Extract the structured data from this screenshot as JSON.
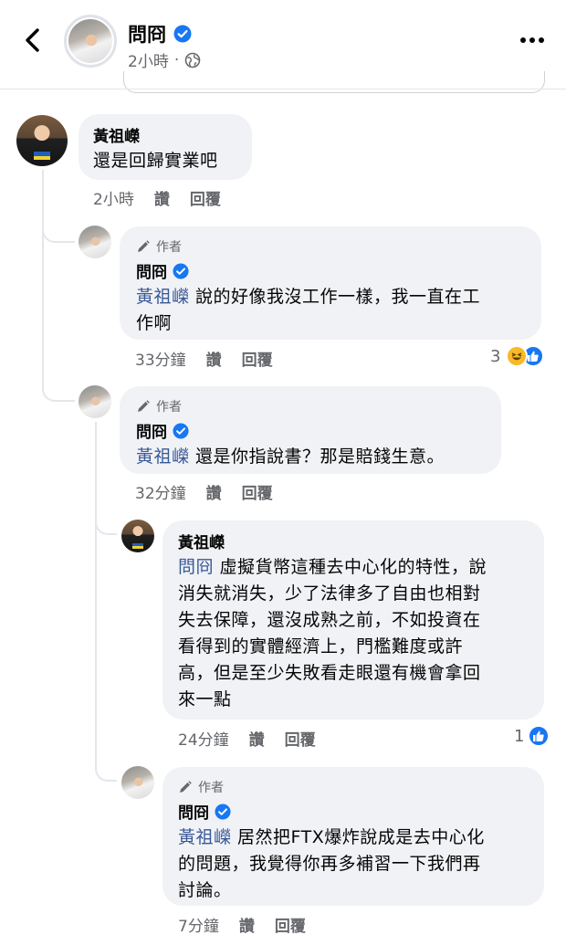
{
  "header": {
    "page_name": "問冏",
    "time": "2小時",
    "separator": "·"
  },
  "comments": [
    {
      "author": "黃祖嶸",
      "text": "還是回歸實業吧",
      "time": "2小時",
      "like": "讚",
      "reply": "回覆"
    },
    {
      "author_tag": "作者",
      "author": "問冏",
      "mention": "黃祖嶸",
      "text_line1": " 說的好像我沒工作一樣，我一直在工",
      "text_line2": "作啊",
      "time": "33分鐘",
      "like": "讚",
      "reply": "回覆",
      "reaction_count": "3"
    },
    {
      "author_tag": "作者",
      "author": "問冏",
      "mention": "黃祖嶸",
      "text": " 還是你指說書？那是賠錢生意。",
      "time": "32分鐘",
      "like": "讚",
      "reply": "回覆"
    },
    {
      "author": "黃祖嶸",
      "mention": "問冏",
      "text_line1": " 虛擬貨幣這種去中心化的特性，說",
      "text_line2": "消失就消失，少了法律多了自由也相對",
      "text_line3": "失去保障，還沒成熟之前，不如投資在",
      "text_line4": "看得到的實體經濟上，門檻難度或許",
      "text_line5": "高，但是至少失敗看走眼還有機會拿回",
      "text_line6": "來一點",
      "time": "24分鐘",
      "like": "讚",
      "reply": "回覆",
      "reaction_count": "1"
    },
    {
      "author_tag": "作者",
      "author": "問冏",
      "mention": "黃祖嶸",
      "text_line1": " 居然把FTX爆炸說成是去中心化",
      "text_line2": "的問題，我覺得你再多補習一下我們再",
      "text_line3": "討論。",
      "time": "7分鐘",
      "like": "讚",
      "reply": "回覆"
    }
  ],
  "colors": {
    "verified": "#1877f2",
    "mention": "#385898",
    "bubble": "#f0f2f5",
    "meta": "#65676b",
    "like_blue": "#1877f2",
    "haha_yellow": "#f7b928"
  },
  "icons": {
    "back": "chevron-left-icon",
    "more": "ellipsis-icon",
    "globe": "globe-icon",
    "verified": "verified-badge-icon",
    "author": "pencil-icon",
    "like_reaction": "like-reaction-icon",
    "haha_reaction": "haha-reaction-icon"
  }
}
